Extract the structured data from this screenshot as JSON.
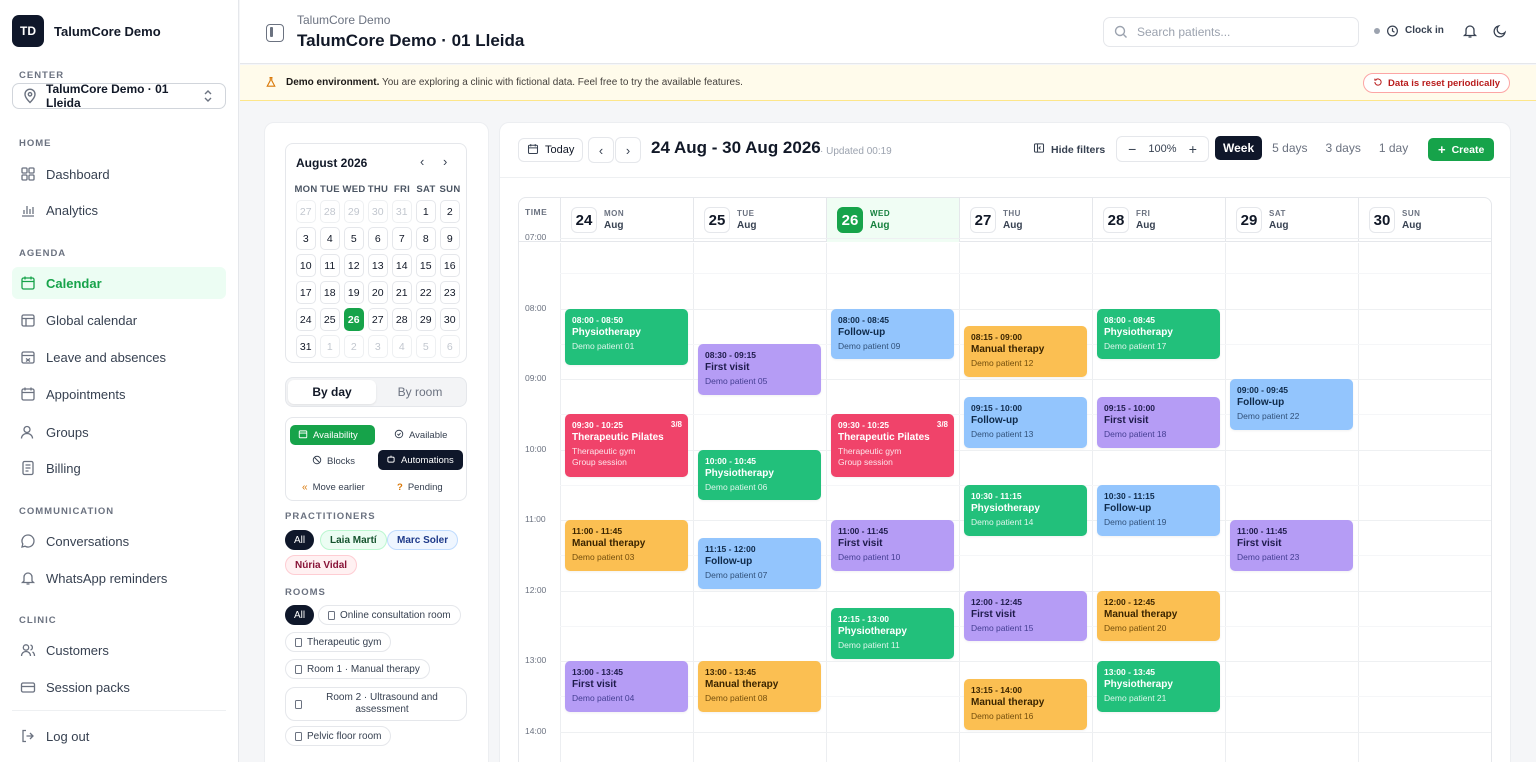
{
  "app": {
    "initials": "TD",
    "name": "TalumCore Demo"
  },
  "sidebar": {
    "center_label": "CENTER",
    "center_value": "TalumCore Demo · 01 Lleida",
    "sections": {
      "home": "HOME",
      "agenda": "AGENDA",
      "communication": "COMMUNICATION",
      "clinic": "CLINIC"
    },
    "items": [
      {
        "label": "Dashboard",
        "icon": "dashboard-icon"
      },
      {
        "label": "Analytics",
        "icon": "analytics-icon"
      },
      {
        "label": "Calendar",
        "icon": "calendar-icon",
        "active": true
      },
      {
        "label": "Global calendar",
        "icon": "global-calendar-icon"
      },
      {
        "label": "Leave and absences",
        "icon": "leave-icon"
      },
      {
        "label": "Appointments",
        "icon": "appointments-icon"
      },
      {
        "label": "Groups",
        "icon": "groups-icon"
      },
      {
        "label": "Billing",
        "icon": "billing-icon"
      },
      {
        "label": "Conversations",
        "icon": "conversations-icon"
      },
      {
        "label": "WhatsApp reminders",
        "icon": "bell-icon"
      },
      {
        "label": "Customers",
        "icon": "customers-icon"
      },
      {
        "label": "Session packs",
        "icon": "session-packs-icon"
      }
    ],
    "logout": "Log out"
  },
  "header": {
    "breadcrumb": "TalumCore Demo",
    "title": "TalumCore Demo · 01 Lleida",
    "search_placeholder": "Search patients...",
    "clock_in": "Clock in"
  },
  "banner": {
    "strong": "Demo environment.",
    "text": " You are exploring a clinic with fictional data. Feel free to try the available features.",
    "reset": "Data is reset periodically"
  },
  "mini_calendar": {
    "month": "August 2026",
    "weekdays": [
      "MON",
      "TUE",
      "WED",
      "THU",
      "FRI",
      "SAT",
      "SUN"
    ],
    "rows": [
      [
        "27",
        "28",
        "29",
        "30",
        "31",
        "1",
        "2"
      ],
      [
        "3",
        "4",
        "5",
        "6",
        "7",
        "8",
        "9"
      ],
      [
        "10",
        "11",
        "12",
        "13",
        "14",
        "15",
        "16"
      ],
      [
        "17",
        "18",
        "19",
        "20",
        "21",
        "22",
        "23"
      ],
      [
        "24",
        "25",
        "26",
        "27",
        "28",
        "29",
        "30"
      ],
      [
        "31",
        "1",
        "2",
        "3",
        "4",
        "5",
        "6"
      ]
    ],
    "today": "26"
  },
  "filters": {
    "by_day": "By day",
    "by_room": "By room",
    "chips": {
      "availability": "Availability",
      "available": "Available",
      "blocks": "Blocks",
      "automations": "Automations",
      "move_earlier": "Move earlier",
      "pending": "Pending"
    },
    "practitioners_label": "PRACTITIONERS",
    "practitioners": [
      "All",
      "Laia Martí",
      "Marc Soler",
      "Núria Vidal"
    ],
    "rooms_label": "ROOMS",
    "rooms": [
      "All",
      "Online consultation room",
      "Therapeutic gym",
      "Room 1 · Manual therapy",
      "Room 2 · Ultrasound and assessment",
      "Pelvic floor room"
    ]
  },
  "toolbar": {
    "today": "Today",
    "range": "24 Aug - 30 Aug 2026",
    "updated": "· Updated 00:19",
    "hide_filters": "Hide filters",
    "zoom": "100%",
    "views": [
      "Week",
      "5 days",
      "3 days",
      "1 day"
    ],
    "create": "Create"
  },
  "calendar": {
    "time_header": "TIME",
    "days": [
      {
        "num": "24",
        "wd": "MON",
        "mo": "Aug"
      },
      {
        "num": "25",
        "wd": "TUE",
        "mo": "Aug"
      },
      {
        "num": "26",
        "wd": "WED",
        "mo": "Aug",
        "today": true
      },
      {
        "num": "27",
        "wd": "THU",
        "mo": "Aug"
      },
      {
        "num": "28",
        "wd": "FRI",
        "mo": "Aug"
      },
      {
        "num": "29",
        "wd": "SAT",
        "mo": "Aug"
      },
      {
        "num": "30",
        "wd": "SUN",
        "mo": "Aug"
      }
    ],
    "times": [
      "07:00",
      "08:00",
      "09:00",
      "10:00",
      "11:00",
      "12:00",
      "13:00",
      "14:00"
    ],
    "events": [
      {
        "day": 0,
        "start": 8.0,
        "end": 8.8333,
        "time": "08:00 - 08:50",
        "title": "Physiotherapy",
        "patient": "Demo patient 01",
        "color": "green"
      },
      {
        "day": 0,
        "start": 9.5,
        "end": 10.4167,
        "time": "09:30 - 10:25",
        "title": "Therapeutic Pilates",
        "patient": "Therapeutic gym",
        "extra": "Group session",
        "cap": "3/8",
        "color": "red"
      },
      {
        "day": 0,
        "start": 11.0,
        "end": 11.75,
        "time": "11:00 - 11:45",
        "title": "Manual therapy",
        "patient": "Demo patient 03",
        "color": "orange"
      },
      {
        "day": 0,
        "start": 13.0,
        "end": 13.75,
        "time": "13:00 - 13:45",
        "title": "First visit",
        "patient": "Demo patient 04",
        "color": "purple"
      },
      {
        "day": 1,
        "start": 8.5,
        "end": 9.25,
        "time": "08:30 - 09:15",
        "title": "First visit",
        "patient": "Demo patient 05",
        "color": "purple"
      },
      {
        "day": 1,
        "start": 10.0,
        "end": 10.75,
        "time": "10:00 - 10:45",
        "title": "Physiotherapy",
        "patient": "Demo patient 06",
        "color": "green"
      },
      {
        "day": 1,
        "start": 11.25,
        "end": 12.0,
        "time": "11:15 - 12:00",
        "title": "Follow-up",
        "patient": "Demo patient 07",
        "color": "blue"
      },
      {
        "day": 1,
        "start": 13.0,
        "end": 13.75,
        "time": "13:00 - 13:45",
        "title": "Manual therapy",
        "patient": "Demo patient 08",
        "color": "orange"
      },
      {
        "day": 2,
        "start": 8.0,
        "end": 8.75,
        "time": "08:00 - 08:45",
        "title": "Follow-up",
        "patient": "Demo patient 09",
        "color": "blue"
      },
      {
        "day": 2,
        "start": 9.5,
        "end": 10.4167,
        "time": "09:30 - 10:25",
        "title": "Therapeutic Pilates",
        "patient": "Therapeutic gym",
        "extra": "Group session",
        "cap": "3/8",
        "color": "red"
      },
      {
        "day": 2,
        "start": 11.0,
        "end": 11.75,
        "time": "11:00 - 11:45",
        "title": "First visit",
        "patient": "Demo patient 10",
        "color": "purple"
      },
      {
        "day": 2,
        "start": 12.25,
        "end": 13.0,
        "time": "12:15 - 13:00",
        "title": "Physiotherapy",
        "patient": "Demo patient 11",
        "color": "green"
      },
      {
        "day": 3,
        "start": 8.25,
        "end": 9.0,
        "time": "08:15 - 09:00",
        "title": "Manual therapy",
        "patient": "Demo patient 12",
        "color": "orange"
      },
      {
        "day": 3,
        "start": 9.25,
        "end": 10.0,
        "time": "09:15 - 10:00",
        "title": "Follow-up",
        "patient": "Demo patient 13",
        "color": "blue"
      },
      {
        "day": 3,
        "start": 10.5,
        "end": 11.25,
        "time": "10:30 - 11:15",
        "title": "Physiotherapy",
        "patient": "Demo patient 14",
        "color": "green"
      },
      {
        "day": 3,
        "start": 12.0,
        "end": 12.75,
        "time": "12:00 - 12:45",
        "title": "First visit",
        "patient": "Demo patient 15",
        "color": "purple"
      },
      {
        "day": 3,
        "start": 13.25,
        "end": 14.0,
        "time": "13:15 - 14:00",
        "title": "Manual therapy",
        "patient": "Demo patient 16",
        "color": "orange"
      },
      {
        "day": 4,
        "start": 8.0,
        "end": 8.75,
        "time": "08:00 - 08:45",
        "title": "Physiotherapy",
        "patient": "Demo patient 17",
        "color": "green"
      },
      {
        "day": 4,
        "start": 9.25,
        "end": 10.0,
        "time": "09:15 - 10:00",
        "title": "First visit",
        "patient": "Demo patient 18",
        "color": "purple"
      },
      {
        "day": 4,
        "start": 10.5,
        "end": 11.25,
        "time": "10:30 - 11:15",
        "title": "Follow-up",
        "patient": "Demo patient 19",
        "color": "blue"
      },
      {
        "day": 4,
        "start": 12.0,
        "end": 12.75,
        "time": "12:00 - 12:45",
        "title": "Manual therapy",
        "patient": "Demo patient 20",
        "color": "orange"
      },
      {
        "day": 4,
        "start": 13.0,
        "end": 13.75,
        "time": "13:00 - 13:45",
        "title": "Physiotherapy",
        "patient": "Demo patient 21",
        "color": "green"
      },
      {
        "day": 5,
        "start": 9.0,
        "end": 9.75,
        "time": "09:00 - 09:45",
        "title": "Follow-up",
        "patient": "Demo patient 22",
        "color": "blue"
      },
      {
        "day": 5,
        "start": 11.0,
        "end": 11.75,
        "time": "11:00 - 11:45",
        "title": "First visit",
        "patient": "Demo patient 23",
        "color": "purple"
      }
    ]
  }
}
